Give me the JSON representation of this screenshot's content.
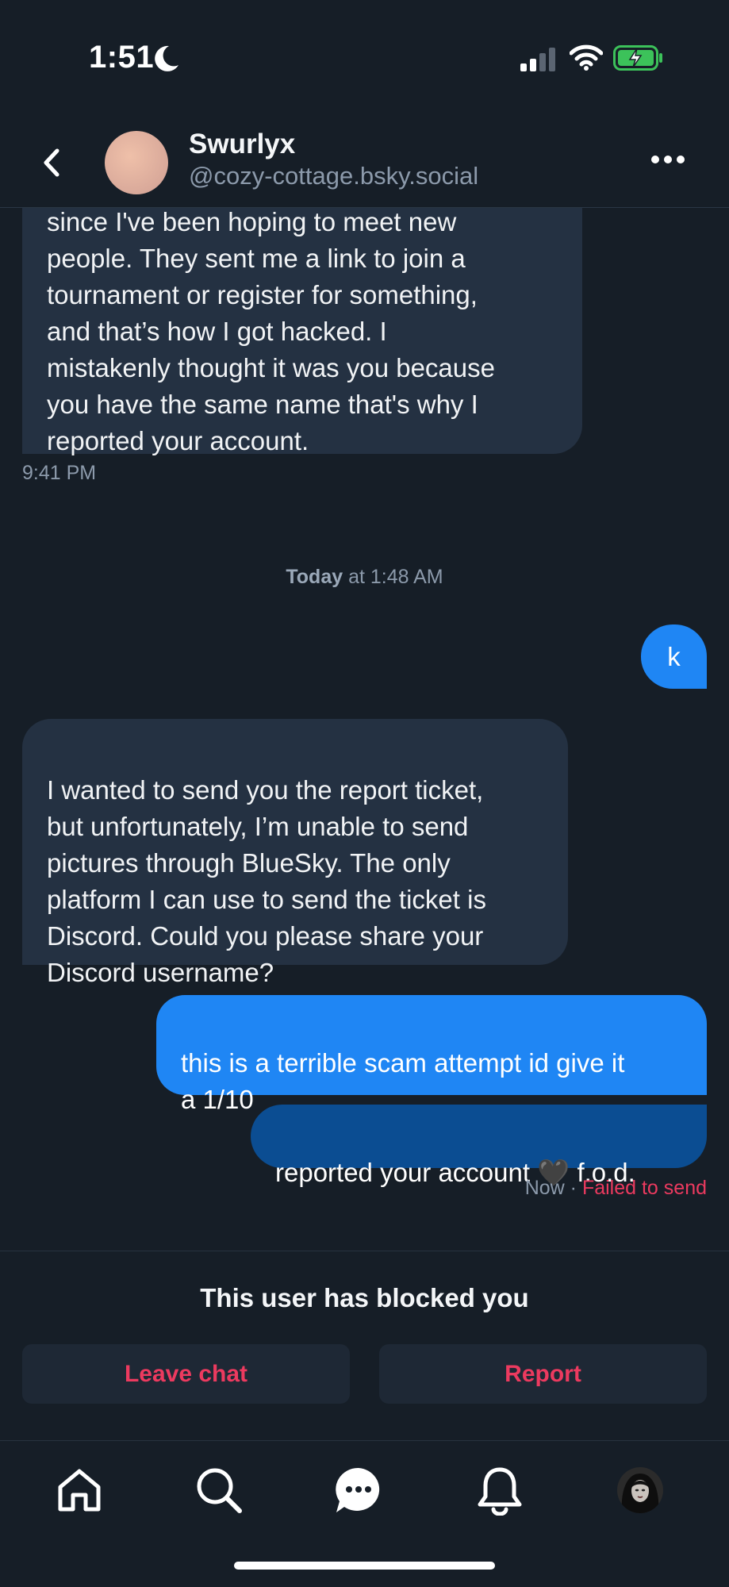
{
  "status_bar": {
    "time": "1:51"
  },
  "header": {
    "name": "Swurlyx",
    "handle": "@cozy-cottage.bsky.social"
  },
  "messages": [
    {
      "direction": "in",
      "text": "since I've been hoping to meet new\npeople. They sent me a link to join a\ntournament or register for something,\nand that’s how I got hacked. I\nmistakenly thought it was you because\nyou have the same name that's why I\nreported your account.",
      "time": "9:41 PM"
    },
    {
      "direction": "out",
      "text": "k"
    },
    {
      "direction": "in",
      "text": "I wanted to send you the report ticket,\nbut unfortunately, I’m unable to send\npictures through BlueSky. The only\nplatform I can use to send the ticket is\nDiscord. Could you please share your\nDiscord username?"
    },
    {
      "direction": "out",
      "text": "this is a terrible scam attempt id give it\na 1/10"
    },
    {
      "direction": "out",
      "text": "reported your account 🖤 f.o.d.",
      "status_time": "Now",
      "status_sep": "·",
      "status_error": "Failed to send"
    }
  ],
  "day_separator": {
    "day": "Today",
    "rest": "at 1:48 AM"
  },
  "blocked": {
    "title": "This user has blocked you",
    "leave_label": "Leave chat",
    "report_label": "Report"
  },
  "tabs": [
    "home",
    "search",
    "chat",
    "notifications",
    "profile"
  ],
  "colors": {
    "background": "#161e27",
    "incoming_bubble": "#243142",
    "outgoing_bubble": "#1f86f4",
    "pending_bubble": "#0b4d92",
    "error": "#ec3a5f"
  }
}
